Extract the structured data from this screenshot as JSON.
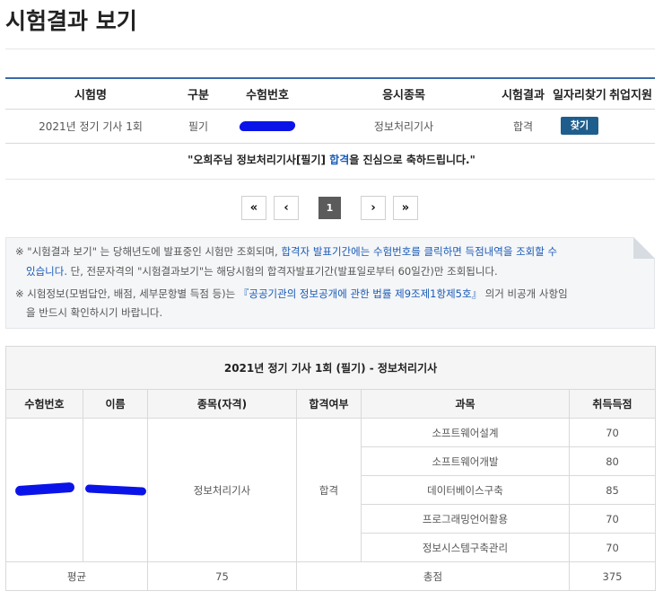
{
  "page": {
    "title": "시험결과 보기"
  },
  "results_table": {
    "headers": [
      "시험명",
      "구분",
      "수험번호",
      "응시종목",
      "시험결과",
      "일자리찾기",
      "취업지원"
    ],
    "row": {
      "exam_name": "2021년 정기 기사 1회",
      "type": "필기",
      "exam_number": "",
      "subject": "정보처리기사",
      "result": "합격",
      "job_button": "찾기",
      "support": ""
    }
  },
  "congrats": {
    "prefix": "\"오희주님 정보처리기사[필기] ",
    "pass": "합격",
    "suffix": "을 진심으로 축하드립니다.\""
  },
  "pagination": {
    "first": "«",
    "prev": "‹",
    "current": "1",
    "next": "›",
    "last": "»"
  },
  "notice": {
    "line1_a": "※ \"시험결과 보기\" 는 당해년도에 발표중인 시험만 조회되며, ",
    "line1_link": "합격자 발표기간에는 수험번호를 클릭하면 득점내역을 조회할 수",
    "line2_link": "있습니다.",
    "line2_b": " 단, 전문자격의 \"시험결과보기\"는 해당시험의 합격자발표기간(발표일로부터 60일간)만 조회됩니다.",
    "line3_a": "※ 시험정보(모범답안, 배점, 세부문항별 득점 등)는 ",
    "line3_link": "『공공기관의 정보공개에 관한 법률 제9조제1항제5호』",
    "line3_b": " 의거 비공개 사항임",
    "line4": "을 반드시 확인하시기 바랍니다."
  },
  "detail": {
    "caption": "2021년 정기 기사 1회 (필기) - 정보처리기사",
    "headers": [
      "수험번호",
      "이름",
      "종목(자격)",
      "합격여부",
      "과목",
      "취득득점"
    ],
    "qualification": "정보처리기사",
    "pass_status": "합격",
    "subjects": [
      {
        "name": "소프트웨어설계",
        "score": "70"
      },
      {
        "name": "소프트웨어개발",
        "score": "80"
      },
      {
        "name": "데이터베이스구축",
        "score": "85"
      },
      {
        "name": "프로그래밍언어활용",
        "score": "70"
      },
      {
        "name": "정보시스템구축관리",
        "score": "70"
      }
    ],
    "average_label": "평균",
    "average_value": "75",
    "total_label": "총점",
    "total_value": "375"
  },
  "colors": {
    "accent": "#3a6aa8",
    "button": "#1f5e8c",
    "link": "#1a5bb5",
    "redaction": "#0a14e8"
  }
}
